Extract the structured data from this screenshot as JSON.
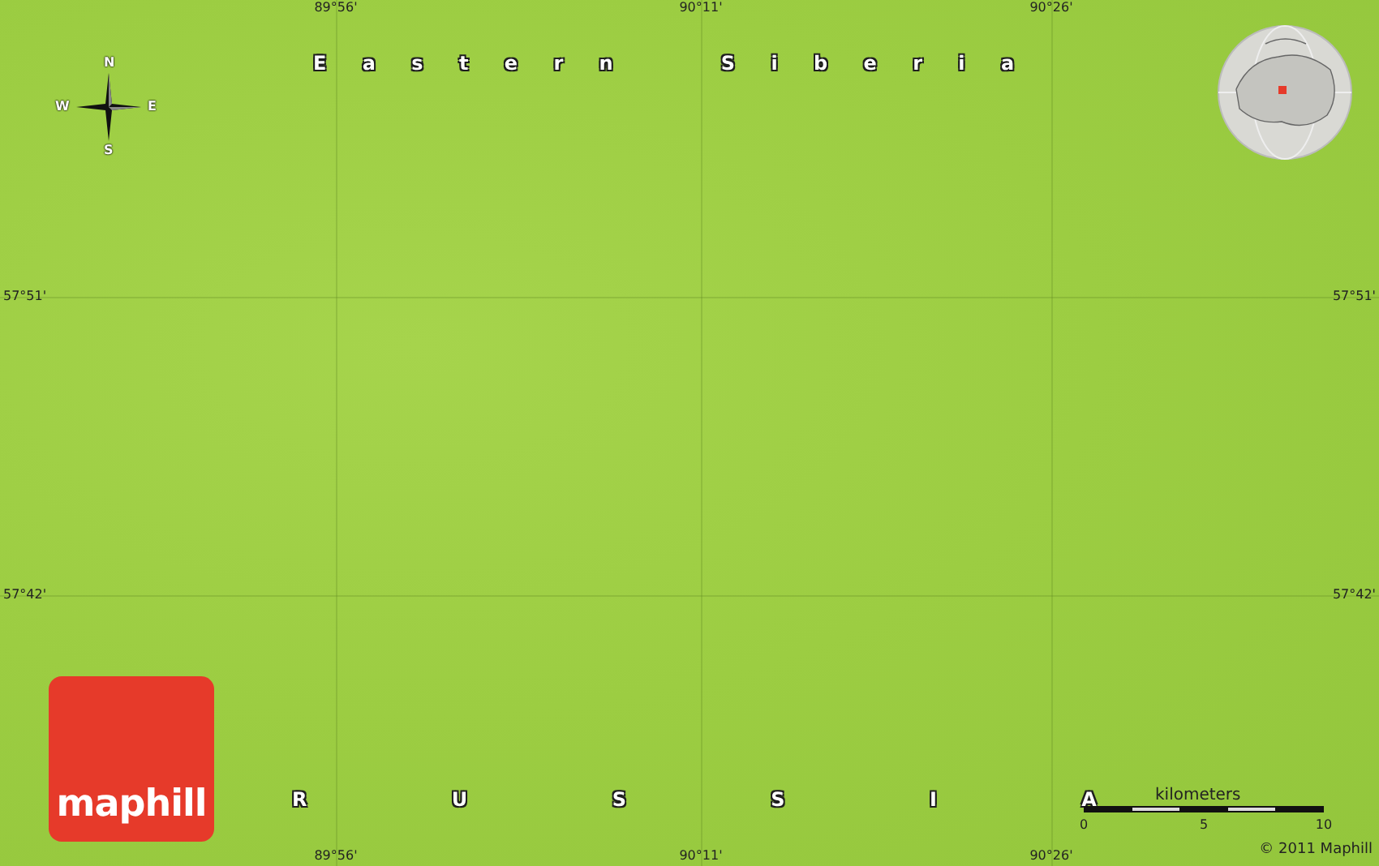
{
  "map": {
    "top_ticks": [
      "89°56'",
      "90°11'",
      "90°26'"
    ],
    "bottom_ticks": [
      "89°56'",
      "90°11'",
      "90°26'"
    ],
    "left_ticks": [
      "57°51'",
      "57°42'"
    ],
    "right_ticks": [
      "57°51'",
      "57°42'"
    ],
    "region_label": "E a s t e r n   S i b e r i a",
    "country_label": "R U S S I A",
    "compass": {
      "north": "N",
      "south": "S",
      "west": "W",
      "east": "E"
    },
    "logo": "maphill",
    "scale": {
      "title": "kilometers",
      "ticks": [
        "0",
        "5",
        "10"
      ]
    },
    "copyright": "© 2011 Maphill"
  }
}
